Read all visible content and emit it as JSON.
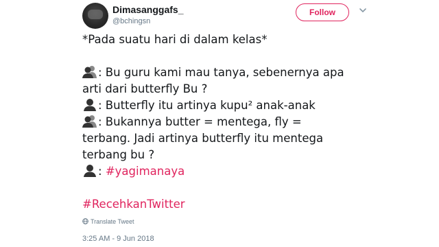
{
  "user": {
    "display_name": "Dimasanggafs_",
    "handle": "@bchingsn"
  },
  "actions": {
    "follow_label": "Follow"
  },
  "tweet": {
    "line1": "*Pada suatu hari di dalam kelas*",
    "line2": ": Bu guru kami mau tanya, sebenernya apa",
    "line3": "arti dari butterfly Bu ?",
    "line4": ": Butterfly itu artinya kupu² anak-anak",
    "line5": ": Bukannya butter = mentega, fly =",
    "line6": "terbang. Jadi artinya butterfly itu mentega",
    "line7": "terbang bu ?",
    "line8_prefix": ": ",
    "line8_hashtag": "#yagimanaya",
    "hashtag2": "#RecehkanTwitter"
  },
  "translate_label": "Translate Tweet",
  "timestamp": "3:25 AM - 9 Jun 2018",
  "icons": {
    "students": "busts-in-silhouette-icon",
    "teacher": "bust-in-silhouette-icon",
    "chevron": "chevron-down-icon",
    "globe": "globe-icon"
  },
  "colors": {
    "accent": "#e0245e",
    "text": "#14171a",
    "muted": "#657786"
  }
}
